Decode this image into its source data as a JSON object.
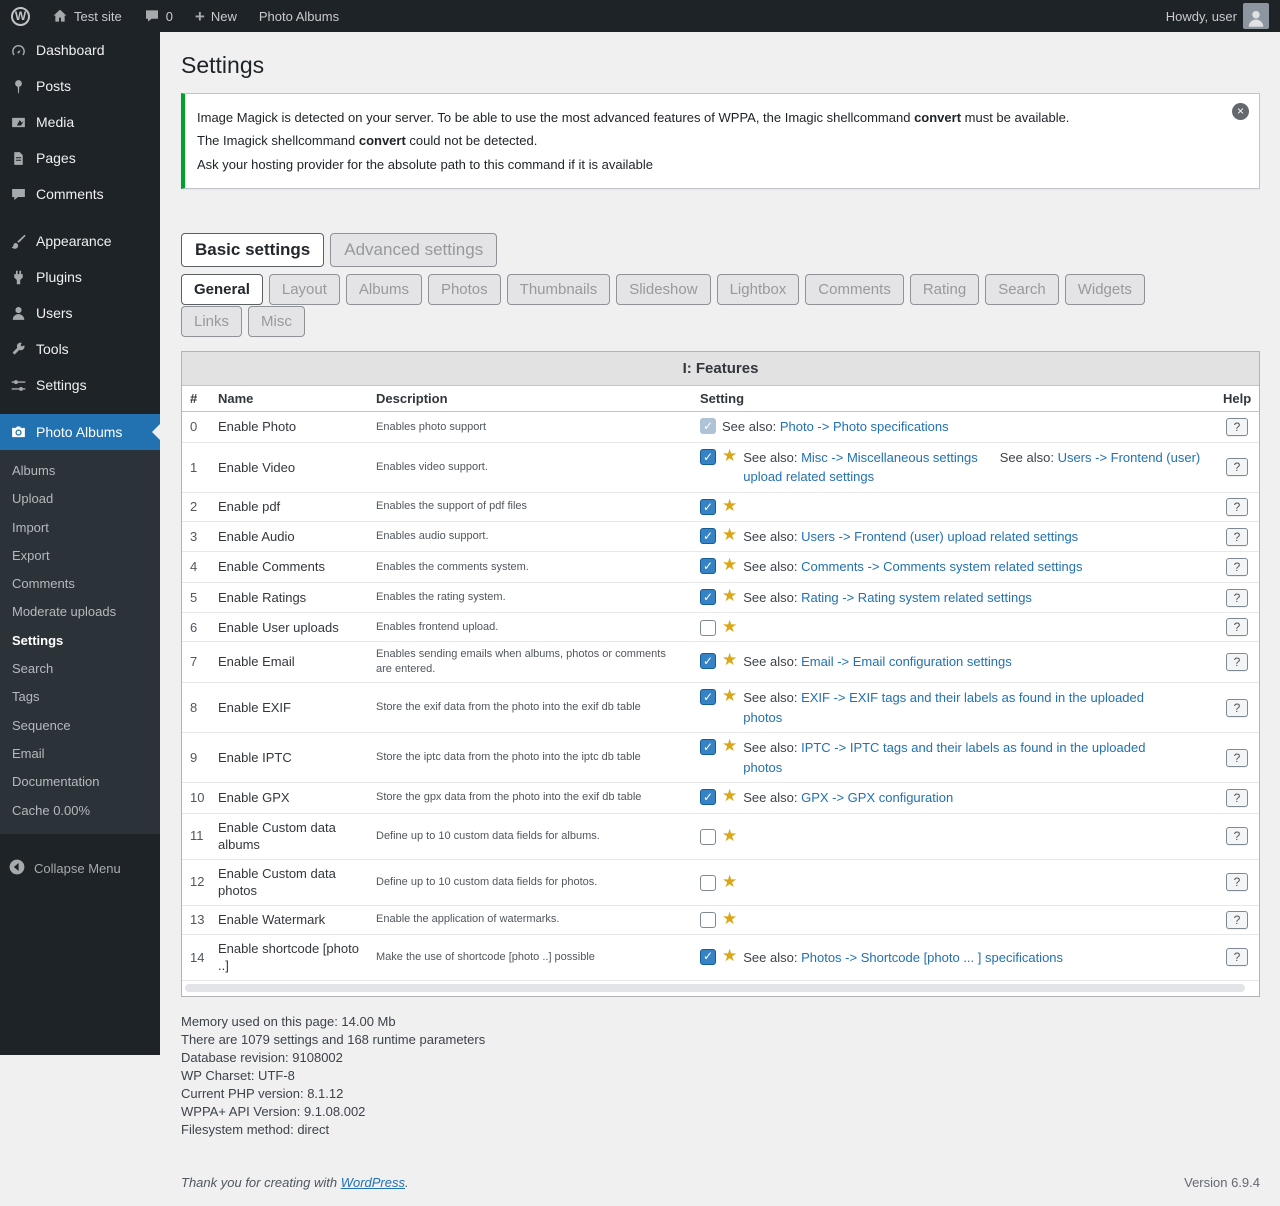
{
  "colors": {
    "accent": "#2271b1",
    "menu_dark": "#1d2327",
    "notice_green": "#00a32a",
    "star_gold": "#dba617",
    "link": "#2271b1"
  },
  "admin_bar": {
    "site_name": "Test site",
    "comments_count": "0",
    "new_label": "New",
    "photo_albums_label": "Photo Albums",
    "howdy": "Howdy, user"
  },
  "sidebar": {
    "items": [
      {
        "label": "Dashboard",
        "icon": "dashboard-icon"
      },
      {
        "label": "Posts",
        "icon": "pin-icon"
      },
      {
        "label": "Media",
        "icon": "media-icon"
      },
      {
        "label": "Pages",
        "icon": "pages-icon"
      },
      {
        "label": "Comments",
        "icon": "comments-icon"
      },
      {
        "separator": true
      },
      {
        "label": "Appearance",
        "icon": "appearance-icon"
      },
      {
        "label": "Plugins",
        "icon": "plugins-icon"
      },
      {
        "label": "Users",
        "icon": "users-icon"
      },
      {
        "label": "Tools",
        "icon": "tools-icon"
      },
      {
        "label": "Settings",
        "icon": "settings-icon"
      },
      {
        "separator": true
      },
      {
        "label": "Photo Albums",
        "icon": "camera-icon",
        "active": true,
        "submenu": [
          {
            "label": "Albums"
          },
          {
            "label": "Upload"
          },
          {
            "label": "Import"
          },
          {
            "label": "Export"
          },
          {
            "label": "Comments"
          },
          {
            "label": "Moderate uploads"
          },
          {
            "label": "Settings",
            "current": true
          },
          {
            "label": "Search"
          },
          {
            "label": "Tags"
          },
          {
            "label": "Sequence"
          },
          {
            "label": "Email"
          },
          {
            "label": "Documentation"
          },
          {
            "label": "Cache 0.00%"
          }
        ]
      }
    ],
    "collapse_label": "Collapse Menu"
  },
  "page": {
    "title": "Settings",
    "notice": {
      "line1": {
        "pre": "Image Magick is detected on your server. To be able to use the most advanced features of WPPA, the Imagic shellcommand ",
        "bold": "convert",
        "post": " must be available."
      },
      "line2": {
        "pre": "The Imagick shellcommand ",
        "bold": "convert",
        "post": " could not be detected."
      },
      "line3": {
        "pre": "Ask your hosting provider for the absolute path to this command if it is available"
      }
    },
    "main_tabs": [
      {
        "label": "Basic settings",
        "active": true
      },
      {
        "label": "Advanced settings",
        "active": false
      }
    ],
    "sub_tabs": [
      {
        "label": "General",
        "active": true
      },
      {
        "label": "Layout",
        "active": false
      },
      {
        "label": "Albums",
        "active": false
      },
      {
        "label": "Photos",
        "active": false
      },
      {
        "label": "Thumbnails",
        "active": false
      },
      {
        "label": "Slideshow",
        "active": false
      },
      {
        "label": "Lightbox",
        "active": false
      },
      {
        "label": "Comments",
        "active": false
      },
      {
        "label": "Rating",
        "active": false
      },
      {
        "label": "Search",
        "active": false
      },
      {
        "label": "Widgets",
        "active": false
      },
      {
        "label": "Links",
        "active": false
      },
      {
        "label": "Misc",
        "active": false
      }
    ],
    "table": {
      "title": "I: Features",
      "columns": [
        "#",
        "Name",
        "Description",
        "Setting",
        "Help"
      ],
      "see_also_label": "See also:",
      "help_label": "?",
      "rows": [
        {
          "num": "0",
          "name": "Enable Photo",
          "desc": "Enables photo support",
          "checked": true,
          "disabled": true,
          "star": false,
          "see_also": [
            "Photo -> Photo specifications"
          ]
        },
        {
          "num": "1",
          "name": "Enable Video",
          "desc": "Enables video support.",
          "checked": true,
          "disabled": false,
          "star": true,
          "see_also": [
            "Misc -> Miscellaneous settings",
            "Users -> Frontend (user) upload related settings"
          ]
        },
        {
          "num": "2",
          "name": "Enable pdf",
          "desc": "Enables the support of pdf files",
          "checked": true,
          "disabled": false,
          "star": true,
          "see_also": []
        },
        {
          "num": "3",
          "name": "Enable Audio",
          "desc": "Enables audio support.",
          "checked": true,
          "disabled": false,
          "star": true,
          "see_also": [
            "Users -> Frontend (user) upload related settings"
          ]
        },
        {
          "num": "4",
          "name": "Enable Comments",
          "desc": "Enables the comments system.",
          "checked": true,
          "disabled": false,
          "star": true,
          "see_also": [
            "Comments -> Comments system related settings"
          ]
        },
        {
          "num": "5",
          "name": "Enable Ratings",
          "desc": "Enables the rating system.",
          "checked": true,
          "disabled": false,
          "star": true,
          "see_also": [
            "Rating -> Rating system related settings"
          ]
        },
        {
          "num": "6",
          "name": "Enable User uploads",
          "desc": "Enables frontend upload.",
          "checked": false,
          "disabled": false,
          "star": true,
          "see_also": []
        },
        {
          "num": "7",
          "name": "Enable Email",
          "desc": "Enables sending emails when albums, photos or comments are entered.",
          "checked": true,
          "disabled": false,
          "star": true,
          "see_also": [
            "Email -> Email configuration settings"
          ]
        },
        {
          "num": "8",
          "name": "Enable EXIF",
          "desc": "Store the exif data from the photo into the exif db table",
          "checked": true,
          "disabled": false,
          "star": true,
          "see_also": [
            "EXIF -> EXIF tags and their labels as found in the uploaded photos"
          ]
        },
        {
          "num": "9",
          "name": "Enable IPTC",
          "desc": "Store the iptc data from the photo into the iptc db table",
          "checked": true,
          "disabled": false,
          "star": true,
          "see_also": [
            "IPTC -> IPTC tags and their labels as found in the uploaded photos"
          ]
        },
        {
          "num": "10",
          "name": "Enable GPX",
          "desc": "Store the gpx data from the photo into the exif db table",
          "checked": true,
          "disabled": false,
          "star": true,
          "see_also": [
            "GPX -> GPX configuration"
          ]
        },
        {
          "num": "11",
          "name": "Enable Custom data albums",
          "desc": "Define up to 10 custom data fields for albums.",
          "checked": false,
          "disabled": false,
          "star": true,
          "see_also": []
        },
        {
          "num": "12",
          "name": "Enable Custom data photos",
          "desc": "Define up to 10 custom data fields for photos.",
          "checked": false,
          "disabled": false,
          "star": true,
          "see_also": []
        },
        {
          "num": "13",
          "name": "Enable Watermark",
          "desc": "Enable the application of watermarks.",
          "checked": false,
          "disabled": false,
          "star": true,
          "see_also": []
        },
        {
          "num": "14",
          "name": "Enable shortcode [photo ..]",
          "desc": "Make the use of shortcode [photo ..] possible",
          "checked": true,
          "disabled": false,
          "star": true,
          "see_also": [
            "Photos -> Shortcode [photo ... ] specifications"
          ]
        }
      ]
    },
    "stats": [
      "Memory used on this page: 14.00 Mb",
      "There are 1079 settings and 168 runtime parameters",
      "Database revision: 9108002",
      "WP Charset: UTF-8",
      "Current PHP version: 8.1.12",
      "WPPA+ API Version: 9.1.08.002",
      "Filesystem method: direct"
    ],
    "footer": {
      "pre": "Thank you for creating with ",
      "link": "WordPress",
      "post": ".",
      "version": "Version 6.9.4"
    }
  }
}
